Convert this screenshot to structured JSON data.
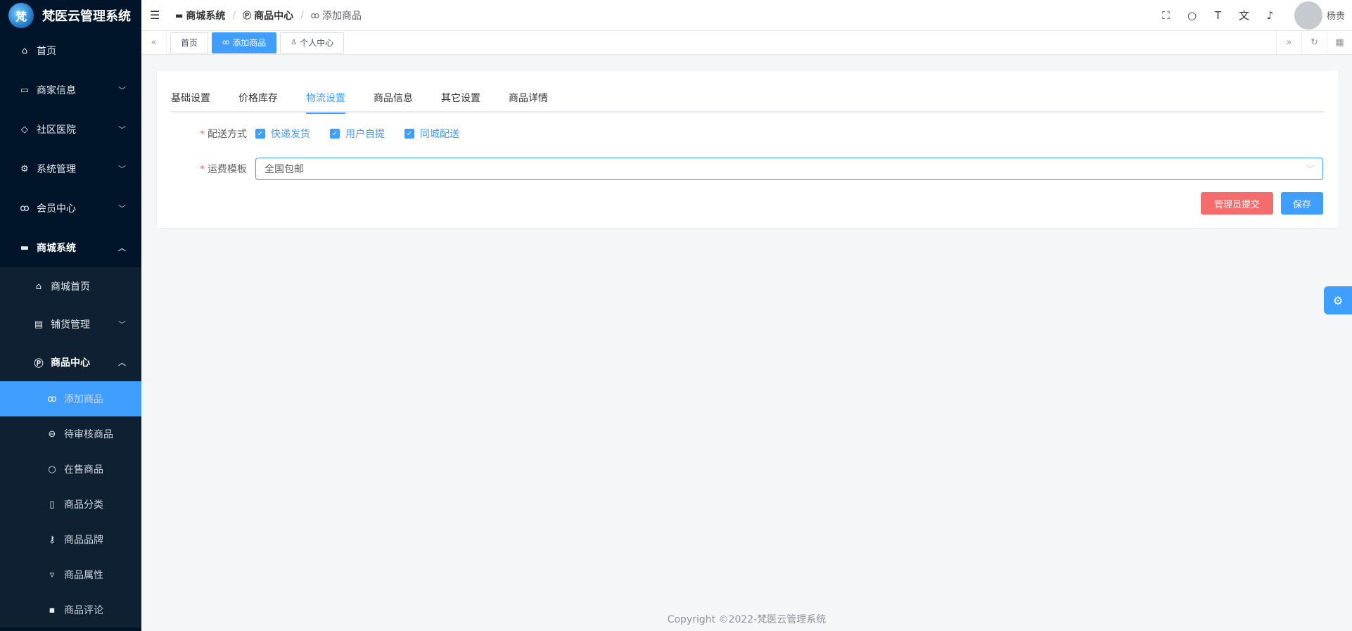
{
  "app": {
    "logo_mark": "梵",
    "title": "梵医云管理系统"
  },
  "sidebar": {
    "items": [
      {
        "label": "首页",
        "icon": "home-icon"
      },
      {
        "label": "商家信息",
        "icon": "shop-icon"
      },
      {
        "label": "社区医院",
        "icon": "hospital-icon"
      },
      {
        "label": "系统管理",
        "icon": "gear-icon"
      },
      {
        "label": "会员中心",
        "icon": "bike-icon"
      },
      {
        "label": "商城系统",
        "icon": "store-icon"
      }
    ],
    "mall_sub": [
      {
        "label": "商城首页",
        "icon": "house-icon"
      },
      {
        "label": "铺货管理",
        "icon": "briefcase-icon"
      },
      {
        "label": "商品中心",
        "icon": "p-circle-icon"
      }
    ],
    "product_sub": [
      {
        "label": "添加商品",
        "icon": "bike-icon"
      },
      {
        "label": "待审核商品",
        "icon": "burger-icon"
      },
      {
        "label": "在售商品",
        "icon": "apple-icon"
      },
      {
        "label": "商品分类",
        "icon": "phone-icon"
      },
      {
        "label": "商品品牌",
        "icon": "key-icon"
      },
      {
        "label": "商品属性",
        "icon": "cocktail-icon"
      },
      {
        "label": "商品评论",
        "icon": "comment-icon"
      }
    ]
  },
  "header": {
    "breadcrumb": [
      "商城系统",
      "商品中心",
      "添加商品"
    ],
    "icons": [
      "fullscreen-icon",
      "search-icon",
      "font-size-icon",
      "translate-icon",
      "bell-icon"
    ],
    "username": "杨贵"
  },
  "tags": [
    {
      "label": "首页"
    },
    {
      "label": "添加商品"
    },
    {
      "label": "个人中心"
    }
  ],
  "form": {
    "tabs": [
      "基础设置",
      "价格库存",
      "物流设置",
      "商品信息",
      "其它设置",
      "商品详情"
    ],
    "active_tab": "物流设置",
    "delivery_label": "配送方式",
    "delivery_options": [
      "快递发货",
      "用户自提",
      "同城配送"
    ],
    "template_label": "运费模板",
    "template_value": "全国包邮",
    "admin_submit": "管理员提交",
    "save": "保存"
  },
  "footer": {
    "copyright": "Copyright ©2022-梵医云管理系统"
  },
  "colors": {
    "sidebar_bg": "#001529",
    "primary": "#409eff",
    "danger": "#f56c6c"
  }
}
